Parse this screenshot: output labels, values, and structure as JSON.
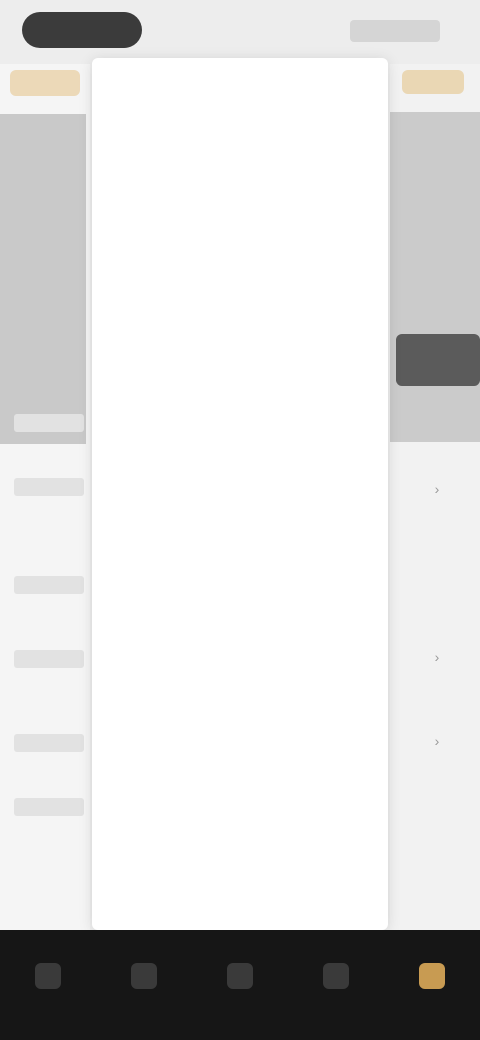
{
  "header": {
    "pill_label": "",
    "right_label": ""
  },
  "menu": {
    "items": [
      {
        "label": ""
      },
      {
        "label": ""
      },
      {
        "label": ""
      },
      {
        "label": ""
      },
      {
        "label": ""
      },
      {
        "label": ""
      },
      {
        "label": ""
      },
      {
        "label": ""
      },
      {
        "label": ""
      },
      {
        "label": ""
      },
      {
        "label": ""
      },
      {
        "label": ""
      },
      {
        "label": ""
      },
      {
        "label": ""
      },
      {
        "label": ""
      },
      {
        "label": ""
      },
      {
        "label": ""
      },
      {
        "label": ""
      }
    ]
  },
  "left_labels": [
    "",
    "",
    "",
    "",
    "",
    ""
  ],
  "bottom_nav": {
    "items": [
      {
        "label": "",
        "icon": "home-icon"
      },
      {
        "label": "",
        "icon": "category-icon"
      },
      {
        "label": "",
        "icon": "discover-icon"
      },
      {
        "label": "",
        "icon": "cart-icon"
      },
      {
        "label": "",
        "icon": "profile-icon",
        "active": true
      }
    ]
  },
  "colors": {
    "accent": "#c89b52",
    "nav_bg": "#161616",
    "menu_bg": "#ffffff",
    "dark_pill": "#3b3b3b"
  }
}
